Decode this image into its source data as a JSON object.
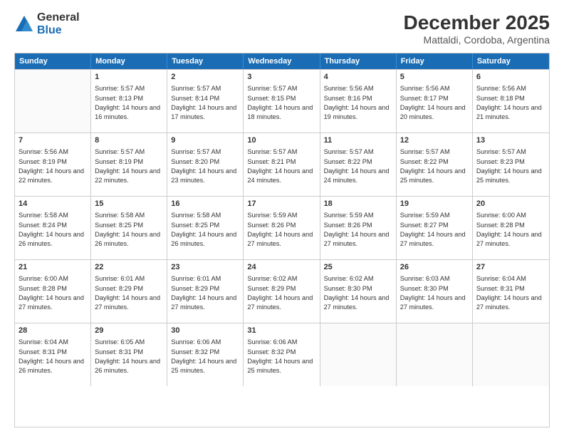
{
  "logo": {
    "general": "General",
    "blue": "Blue"
  },
  "title": {
    "month": "December 2025",
    "location": "Mattaldi, Cordoba, Argentina"
  },
  "days": [
    "Sunday",
    "Monday",
    "Tuesday",
    "Wednesday",
    "Thursday",
    "Friday",
    "Saturday"
  ],
  "weeks": [
    [
      {
        "date": "",
        "sunrise": "",
        "sunset": "",
        "daylight": ""
      },
      {
        "date": "1",
        "sunrise": "Sunrise: 5:57 AM",
        "sunset": "Sunset: 8:13 PM",
        "daylight": "Daylight: 14 hours and 16 minutes."
      },
      {
        "date": "2",
        "sunrise": "Sunrise: 5:57 AM",
        "sunset": "Sunset: 8:14 PM",
        "daylight": "Daylight: 14 hours and 17 minutes."
      },
      {
        "date": "3",
        "sunrise": "Sunrise: 5:57 AM",
        "sunset": "Sunset: 8:15 PM",
        "daylight": "Daylight: 14 hours and 18 minutes."
      },
      {
        "date": "4",
        "sunrise": "Sunrise: 5:56 AM",
        "sunset": "Sunset: 8:16 PM",
        "daylight": "Daylight: 14 hours and 19 minutes."
      },
      {
        "date": "5",
        "sunrise": "Sunrise: 5:56 AM",
        "sunset": "Sunset: 8:17 PM",
        "daylight": "Daylight: 14 hours and 20 minutes."
      },
      {
        "date": "6",
        "sunrise": "Sunrise: 5:56 AM",
        "sunset": "Sunset: 8:18 PM",
        "daylight": "Daylight: 14 hours and 21 minutes."
      }
    ],
    [
      {
        "date": "7",
        "sunrise": "Sunrise: 5:56 AM",
        "sunset": "Sunset: 8:19 PM",
        "daylight": "Daylight: 14 hours and 22 minutes."
      },
      {
        "date": "8",
        "sunrise": "Sunrise: 5:57 AM",
        "sunset": "Sunset: 8:19 PM",
        "daylight": "Daylight: 14 hours and 22 minutes."
      },
      {
        "date": "9",
        "sunrise": "Sunrise: 5:57 AM",
        "sunset": "Sunset: 8:20 PM",
        "daylight": "Daylight: 14 hours and 23 minutes."
      },
      {
        "date": "10",
        "sunrise": "Sunrise: 5:57 AM",
        "sunset": "Sunset: 8:21 PM",
        "daylight": "Daylight: 14 hours and 24 minutes."
      },
      {
        "date": "11",
        "sunrise": "Sunrise: 5:57 AM",
        "sunset": "Sunset: 8:22 PM",
        "daylight": "Daylight: 14 hours and 24 minutes."
      },
      {
        "date": "12",
        "sunrise": "Sunrise: 5:57 AM",
        "sunset": "Sunset: 8:22 PM",
        "daylight": "Daylight: 14 hours and 25 minutes."
      },
      {
        "date": "13",
        "sunrise": "Sunrise: 5:57 AM",
        "sunset": "Sunset: 8:23 PM",
        "daylight": "Daylight: 14 hours and 25 minutes."
      }
    ],
    [
      {
        "date": "14",
        "sunrise": "Sunrise: 5:58 AM",
        "sunset": "Sunset: 8:24 PM",
        "daylight": "Daylight: 14 hours and 26 minutes."
      },
      {
        "date": "15",
        "sunrise": "Sunrise: 5:58 AM",
        "sunset": "Sunset: 8:25 PM",
        "daylight": "Daylight: 14 hours and 26 minutes."
      },
      {
        "date": "16",
        "sunrise": "Sunrise: 5:58 AM",
        "sunset": "Sunset: 8:25 PM",
        "daylight": "Daylight: 14 hours and 26 minutes."
      },
      {
        "date": "17",
        "sunrise": "Sunrise: 5:59 AM",
        "sunset": "Sunset: 8:26 PM",
        "daylight": "Daylight: 14 hours and 27 minutes."
      },
      {
        "date": "18",
        "sunrise": "Sunrise: 5:59 AM",
        "sunset": "Sunset: 8:26 PM",
        "daylight": "Daylight: 14 hours and 27 minutes."
      },
      {
        "date": "19",
        "sunrise": "Sunrise: 5:59 AM",
        "sunset": "Sunset: 8:27 PM",
        "daylight": "Daylight: 14 hours and 27 minutes."
      },
      {
        "date": "20",
        "sunrise": "Sunrise: 6:00 AM",
        "sunset": "Sunset: 8:28 PM",
        "daylight": "Daylight: 14 hours and 27 minutes."
      }
    ],
    [
      {
        "date": "21",
        "sunrise": "Sunrise: 6:00 AM",
        "sunset": "Sunset: 8:28 PM",
        "daylight": "Daylight: 14 hours and 27 minutes."
      },
      {
        "date": "22",
        "sunrise": "Sunrise: 6:01 AM",
        "sunset": "Sunset: 8:29 PM",
        "daylight": "Daylight: 14 hours and 27 minutes."
      },
      {
        "date": "23",
        "sunrise": "Sunrise: 6:01 AM",
        "sunset": "Sunset: 8:29 PM",
        "daylight": "Daylight: 14 hours and 27 minutes."
      },
      {
        "date": "24",
        "sunrise": "Sunrise: 6:02 AM",
        "sunset": "Sunset: 8:29 PM",
        "daylight": "Daylight: 14 hours and 27 minutes."
      },
      {
        "date": "25",
        "sunrise": "Sunrise: 6:02 AM",
        "sunset": "Sunset: 8:30 PM",
        "daylight": "Daylight: 14 hours and 27 minutes."
      },
      {
        "date": "26",
        "sunrise": "Sunrise: 6:03 AM",
        "sunset": "Sunset: 8:30 PM",
        "daylight": "Daylight: 14 hours and 27 minutes."
      },
      {
        "date": "27",
        "sunrise": "Sunrise: 6:04 AM",
        "sunset": "Sunset: 8:31 PM",
        "daylight": "Daylight: 14 hours and 27 minutes."
      }
    ],
    [
      {
        "date": "28",
        "sunrise": "Sunrise: 6:04 AM",
        "sunset": "Sunset: 8:31 PM",
        "daylight": "Daylight: 14 hours and 26 minutes."
      },
      {
        "date": "29",
        "sunrise": "Sunrise: 6:05 AM",
        "sunset": "Sunset: 8:31 PM",
        "daylight": "Daylight: 14 hours and 26 minutes."
      },
      {
        "date": "30",
        "sunrise": "Sunrise: 6:06 AM",
        "sunset": "Sunset: 8:32 PM",
        "daylight": "Daylight: 14 hours and 25 minutes."
      },
      {
        "date": "31",
        "sunrise": "Sunrise: 6:06 AM",
        "sunset": "Sunset: 8:32 PM",
        "daylight": "Daylight: 14 hours and 25 minutes."
      },
      {
        "date": "",
        "sunrise": "",
        "sunset": "",
        "daylight": ""
      },
      {
        "date": "",
        "sunrise": "",
        "sunset": "",
        "daylight": ""
      },
      {
        "date": "",
        "sunrise": "",
        "sunset": "",
        "daylight": ""
      }
    ]
  ]
}
